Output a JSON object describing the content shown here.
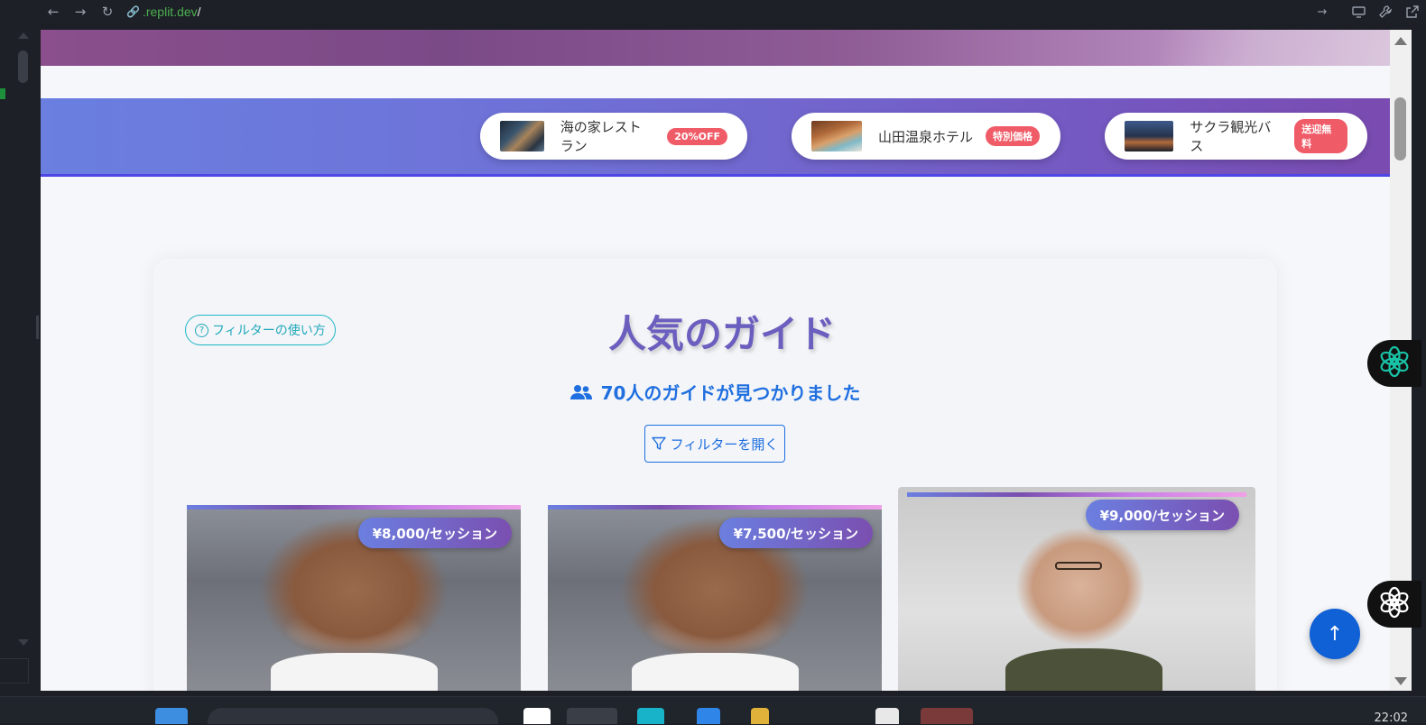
{
  "browser": {
    "url_host": ".replit.dev",
    "url_path": "/"
  },
  "promos": [
    {
      "name": "海の家レストラン",
      "badge": "20%OFF"
    },
    {
      "name": "山田温泉ホテル",
      "badge": "特別価格"
    },
    {
      "name": "サクラ観光バス",
      "badge": "送迎無料"
    }
  ],
  "section": {
    "help_label": "フィルターの使い方",
    "title": "人気のガイド",
    "count_text": "70人のガイドが見つかりました",
    "filter_label": "フィルターを開く"
  },
  "guides": [
    {
      "price": "¥8,000/セッション"
    },
    {
      "price": "¥7,500/セッション"
    },
    {
      "price": "¥9,000/セッション"
    }
  ],
  "taskbar": {
    "clock": "22:02"
  },
  "colors": {
    "accent_purple": "#6a5fbf",
    "primary_blue": "#1f6fe0",
    "badge_red": "#ef5c68",
    "help_teal": "#20a9bb"
  }
}
